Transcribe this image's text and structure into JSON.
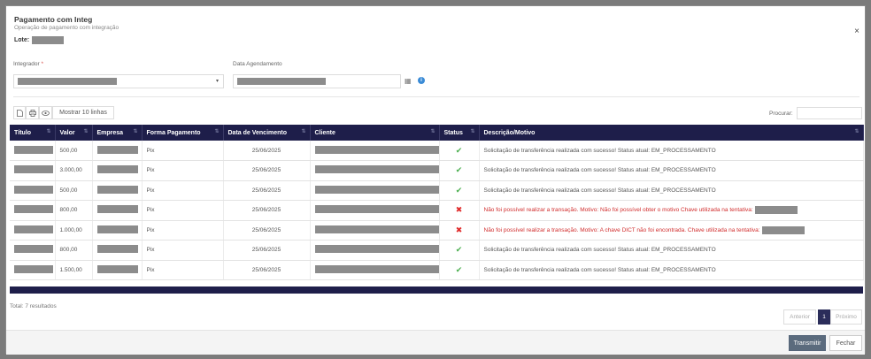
{
  "modal": {
    "title": "Pagamento com Integ",
    "subtitle": "Operação de pagamento com integração",
    "lote_label": "Lote:",
    "close": "×"
  },
  "filters": {
    "integrador_label": "Integrador",
    "required_mark": "*",
    "data_agendamento_label": "Data Agendamento"
  },
  "toolbar": {
    "show_rows_label": "Mostrar 10 linhas",
    "search_label": "Procurar:"
  },
  "table": {
    "columns": [
      "Título",
      "Valor",
      "Empresa",
      "Forma Pagamento",
      "Data de Vencimento",
      "Cliente",
      "Status",
      "Descrição/Motivo"
    ],
    "rows": [
      {
        "valor": "500,00",
        "forma": "Pix",
        "vencimento": "25/06/2025",
        "status": "ok",
        "descricao": "Solicitação de transferência realizada com sucesso! Status atual: EM_PROCESSAMENTO"
      },
      {
        "valor": "3.000,00",
        "forma": "Pix",
        "vencimento": "25/06/2025",
        "status": "ok",
        "descricao": "Solicitação de transferência realizada com sucesso! Status atual: EM_PROCESSAMENTO"
      },
      {
        "valor": "500,00",
        "forma": "Pix",
        "vencimento": "25/06/2025",
        "status": "ok",
        "descricao": "Solicitação de transferência realizada com sucesso! Status atual: EM_PROCESSAMENTO"
      },
      {
        "valor": "800,00",
        "forma": "Pix",
        "vencimento": "25/06/2025",
        "status": "error",
        "descricao": "Não foi possível realizar a transação. Motivo: Não foi possível obter o motivo Chave utilizada na tentativa:"
      },
      {
        "valor": "1.000,00",
        "forma": "Pix",
        "vencimento": "25/06/2025",
        "status": "error",
        "descricao": "Não foi possível realizar a transação. Motivo: A chave DICT não foi encontrada. Chave utilizada na tentativa:"
      },
      {
        "valor": "800,00",
        "forma": "Pix",
        "vencimento": "25/06/2025",
        "status": "ok",
        "descricao": "Solicitação de transferência realizada com sucesso! Status atual: EM_PROCESSAMENTO"
      },
      {
        "valor": "1.500,00",
        "forma": "Pix",
        "vencimento": "25/06/2025",
        "status": "ok",
        "descricao": "Solicitação de transferência realizada com sucesso! Status atual: EM_PROCESSAMENTO"
      }
    ]
  },
  "footer": {
    "total": "Total: 7 resultados",
    "prev": "Anterior",
    "page": "1",
    "next": "Próximo",
    "transmit": "Transmitir",
    "close": "Fechar"
  },
  "colors": {
    "header_bg": "#1e1e4a",
    "success": "#4caf50",
    "error": "#e02b2b"
  },
  "icons": {
    "ok": "✔",
    "error": "✖",
    "sort": "⇅",
    "calendar": "▦",
    "info": "i"
  }
}
